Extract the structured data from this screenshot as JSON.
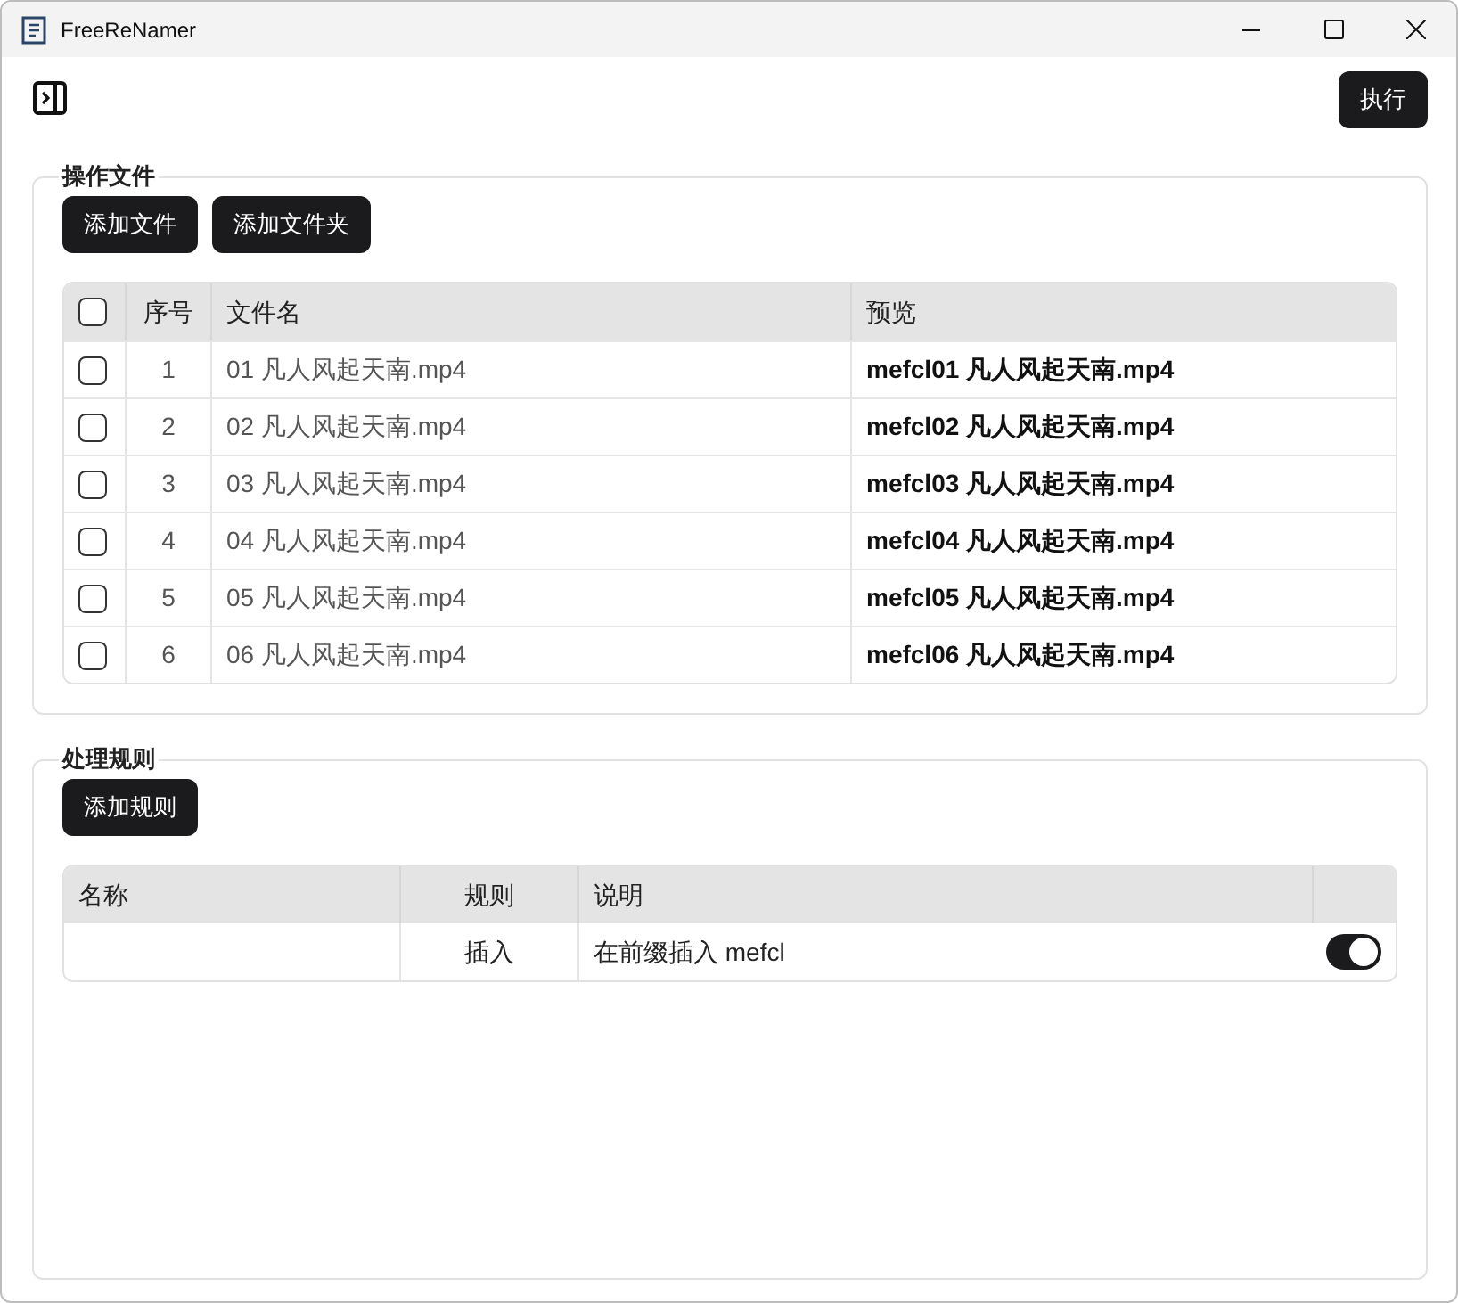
{
  "window": {
    "title": "FreeReNamer"
  },
  "toolbar": {
    "execute_button": "执行"
  },
  "files_section": {
    "title": "操作文件",
    "buttons": [
      "添加文件",
      "添加文件夹"
    ],
    "table": {
      "select_all_checked": false,
      "columns": [
        "序号",
        "文件名",
        "预览"
      ],
      "rows": [
        {
          "checked": false,
          "index": "1",
          "filename": "01 凡人风起天南.mp4",
          "preview": "mefcl01 凡人风起天南.mp4"
        },
        {
          "checked": false,
          "index": "2",
          "filename": "02 凡人风起天南.mp4",
          "preview": "mefcl02 凡人风起天南.mp4"
        },
        {
          "checked": false,
          "index": "3",
          "filename": "03 凡人风起天南.mp4",
          "preview": "mefcl03 凡人风起天南.mp4"
        },
        {
          "checked": false,
          "index": "4",
          "filename": "04 凡人风起天南.mp4",
          "preview": "mefcl04 凡人风起天南.mp4"
        },
        {
          "checked": false,
          "index": "5",
          "filename": "05 凡人风起天南.mp4",
          "preview": "mefcl05 凡人风起天南.mp4"
        },
        {
          "checked": false,
          "index": "6",
          "filename": "06 凡人风起天南.mp4",
          "preview": "mefcl06 凡人风起天南.mp4"
        }
      ]
    }
  },
  "rules_section": {
    "title": "处理规则",
    "buttons": [
      "添加规则"
    ],
    "table": {
      "columns": [
        "名称",
        "规则",
        "说明"
      ],
      "rows": [
        {
          "rule": "插入",
          "description": "在前缀插入 mefcl",
          "on": true
        }
      ]
    }
  }
}
